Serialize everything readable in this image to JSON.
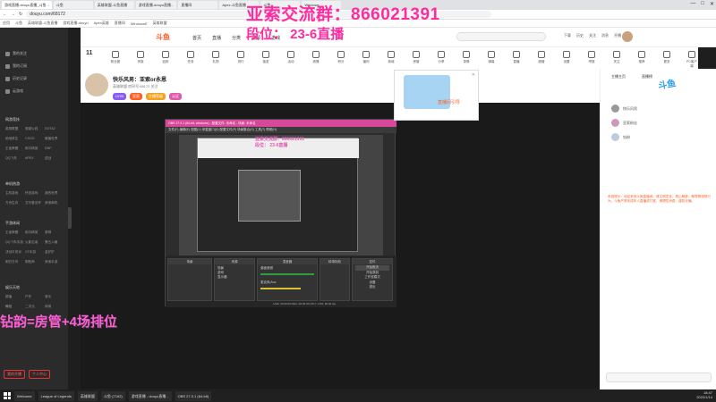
{
  "browser": {
    "tabs": [
      "游戏直播-douyu直播_斗鱼...",
      "斗鱼",
      "英雄联盟-斗鱼直播",
      "游戏直播-douyu直播...",
      "直播间",
      "Apex-斗鱼直播",
      "斗鱼",
      "Windows"
    ],
    "url": "douyu.com/68172",
    "bookmarks": [
      "应用",
      "斗鱼",
      "英雄联盟-斗鱼直播",
      "游戏直播-douyu",
      "Apex英雄",
      "直播间",
      "WindowsE",
      "英雄联盟"
    ],
    "window_controls": [
      "—",
      "□",
      "✕"
    ]
  },
  "overlay": {
    "line1": "亚索交流群：866021391",
    "line2": "段位： 23-6直播",
    "bottom": "钻韵=房管+4场排位",
    "stream_line1": "亚索交流群：866021391",
    "stream_line2": "段位： 23-6直播"
  },
  "site": {
    "logo": "斗鱼",
    "nav": [
      "首页",
      "直播",
      "分类",
      "视频",
      "游戏"
    ],
    "header_icons": [
      "下载",
      "历史",
      "关注",
      "消息",
      "开播"
    ]
  },
  "sidebar": {
    "top_items": [
      "我的关注",
      "我的订阅",
      "历史记录",
      "云游戏"
    ],
    "section1": "网游竞技",
    "grid1": [
      "英雄联盟",
      "穿越火线",
      "DOTA2",
      "绝地求生",
      "CSGO",
      "魔兽世界",
      "王者荣耀",
      "和平精英",
      "DNF",
      "QQ飞车",
      "APEX",
      "逆战"
    ],
    "section2": "单机热游",
    "grid2": [
      "主机游戏",
      "怀旧游戏",
      "我的世界",
      "方舟生存",
      "艾尔登法环",
      "其他单机"
    ],
    "section3": "手游休闲",
    "grid3": [
      "王者荣耀",
      "和平精英",
      "原神",
      "QQ飞车手游",
      "火影忍者",
      "第五人格",
      "决战平安京",
      "CF手游",
      "金铲铲",
      "明日方舟",
      "阴阳师",
      "其他手游"
    ],
    "section4": "娱乐天地",
    "grid4": [
      "颜值",
      "户外",
      "音乐",
      "舞蹈",
      "二次元",
      "体育"
    ],
    "bottom_buttons": [
      "我的开播",
      "个人中心"
    ]
  },
  "icon_strip": {
    "count": "11",
    "items": [
      "粉丝团",
      "贵族",
      "钻粉",
      "任务",
      "礼物",
      "排行",
      "抽奖",
      "活动",
      "竞猜",
      "积分",
      "福利",
      "商城",
      "房管",
      "分享",
      "录像",
      "弹幕",
      "直播",
      "超管",
      "设置",
      "举报",
      "关注",
      "推荐",
      "更多",
      "PC客户端"
    ]
  },
  "streamer": {
    "title": "快乐风男：亚索or永恩",
    "meta": "英雄联盟  房间号:68172  关注",
    "badges": [
      "LV99",
      "亚索",
      "主播等级",
      "认证"
    ]
  },
  "popup": {
    "text": "直播间引导",
    "close": "✕"
  },
  "obs": {
    "title": "OBS 27.0.1 (64-bit, windows) - 配置文件: 未命名 - 场景: 未命名",
    "menu": "文件(F)  编辑(E)  视图(V)  停靠窗口(D)  配置文件(P)  场景集合(S)  工具(T)  帮助(H)",
    "docks": [
      "场景",
      "来源",
      "混音器",
      "转场特效",
      "控件"
    ],
    "sources": [
      "场景",
      "游戏",
      "显示器"
    ],
    "mixer": [
      "桌面音频",
      "麦克风/Aux"
    ],
    "controls": [
      "开始推流",
      "开始录制",
      "工作室模式",
      "设置",
      "退出"
    ],
    "status": "LIVE: 00:00:00  REC: 00:00:00  CPU: 1.5%, 60.00 fps"
  },
  "chat": {
    "tabs": [
      "主播主页",
      "直播榜"
    ],
    "users": [
      "快乐风男",
      "亚索粉丝",
      "钻粉"
    ],
    "notice": "系统提示：欢迎来到斗鱼直播间，请文明发言，禁止刷屏、辱骂等违规行为，斗鱼严禁未成年人直播或打赏，请理性消费，谨防诈骗。"
  },
  "taskbar": {
    "items": [
      "Welcome",
      "League of Legends",
      "英雄联盟",
      "斗鱼·(7162)",
      "游戏直播 - douyu直播...",
      "OBS 27.0.1 (64-bit)"
    ],
    "time": "18:47",
    "date": "2022/1/14"
  }
}
